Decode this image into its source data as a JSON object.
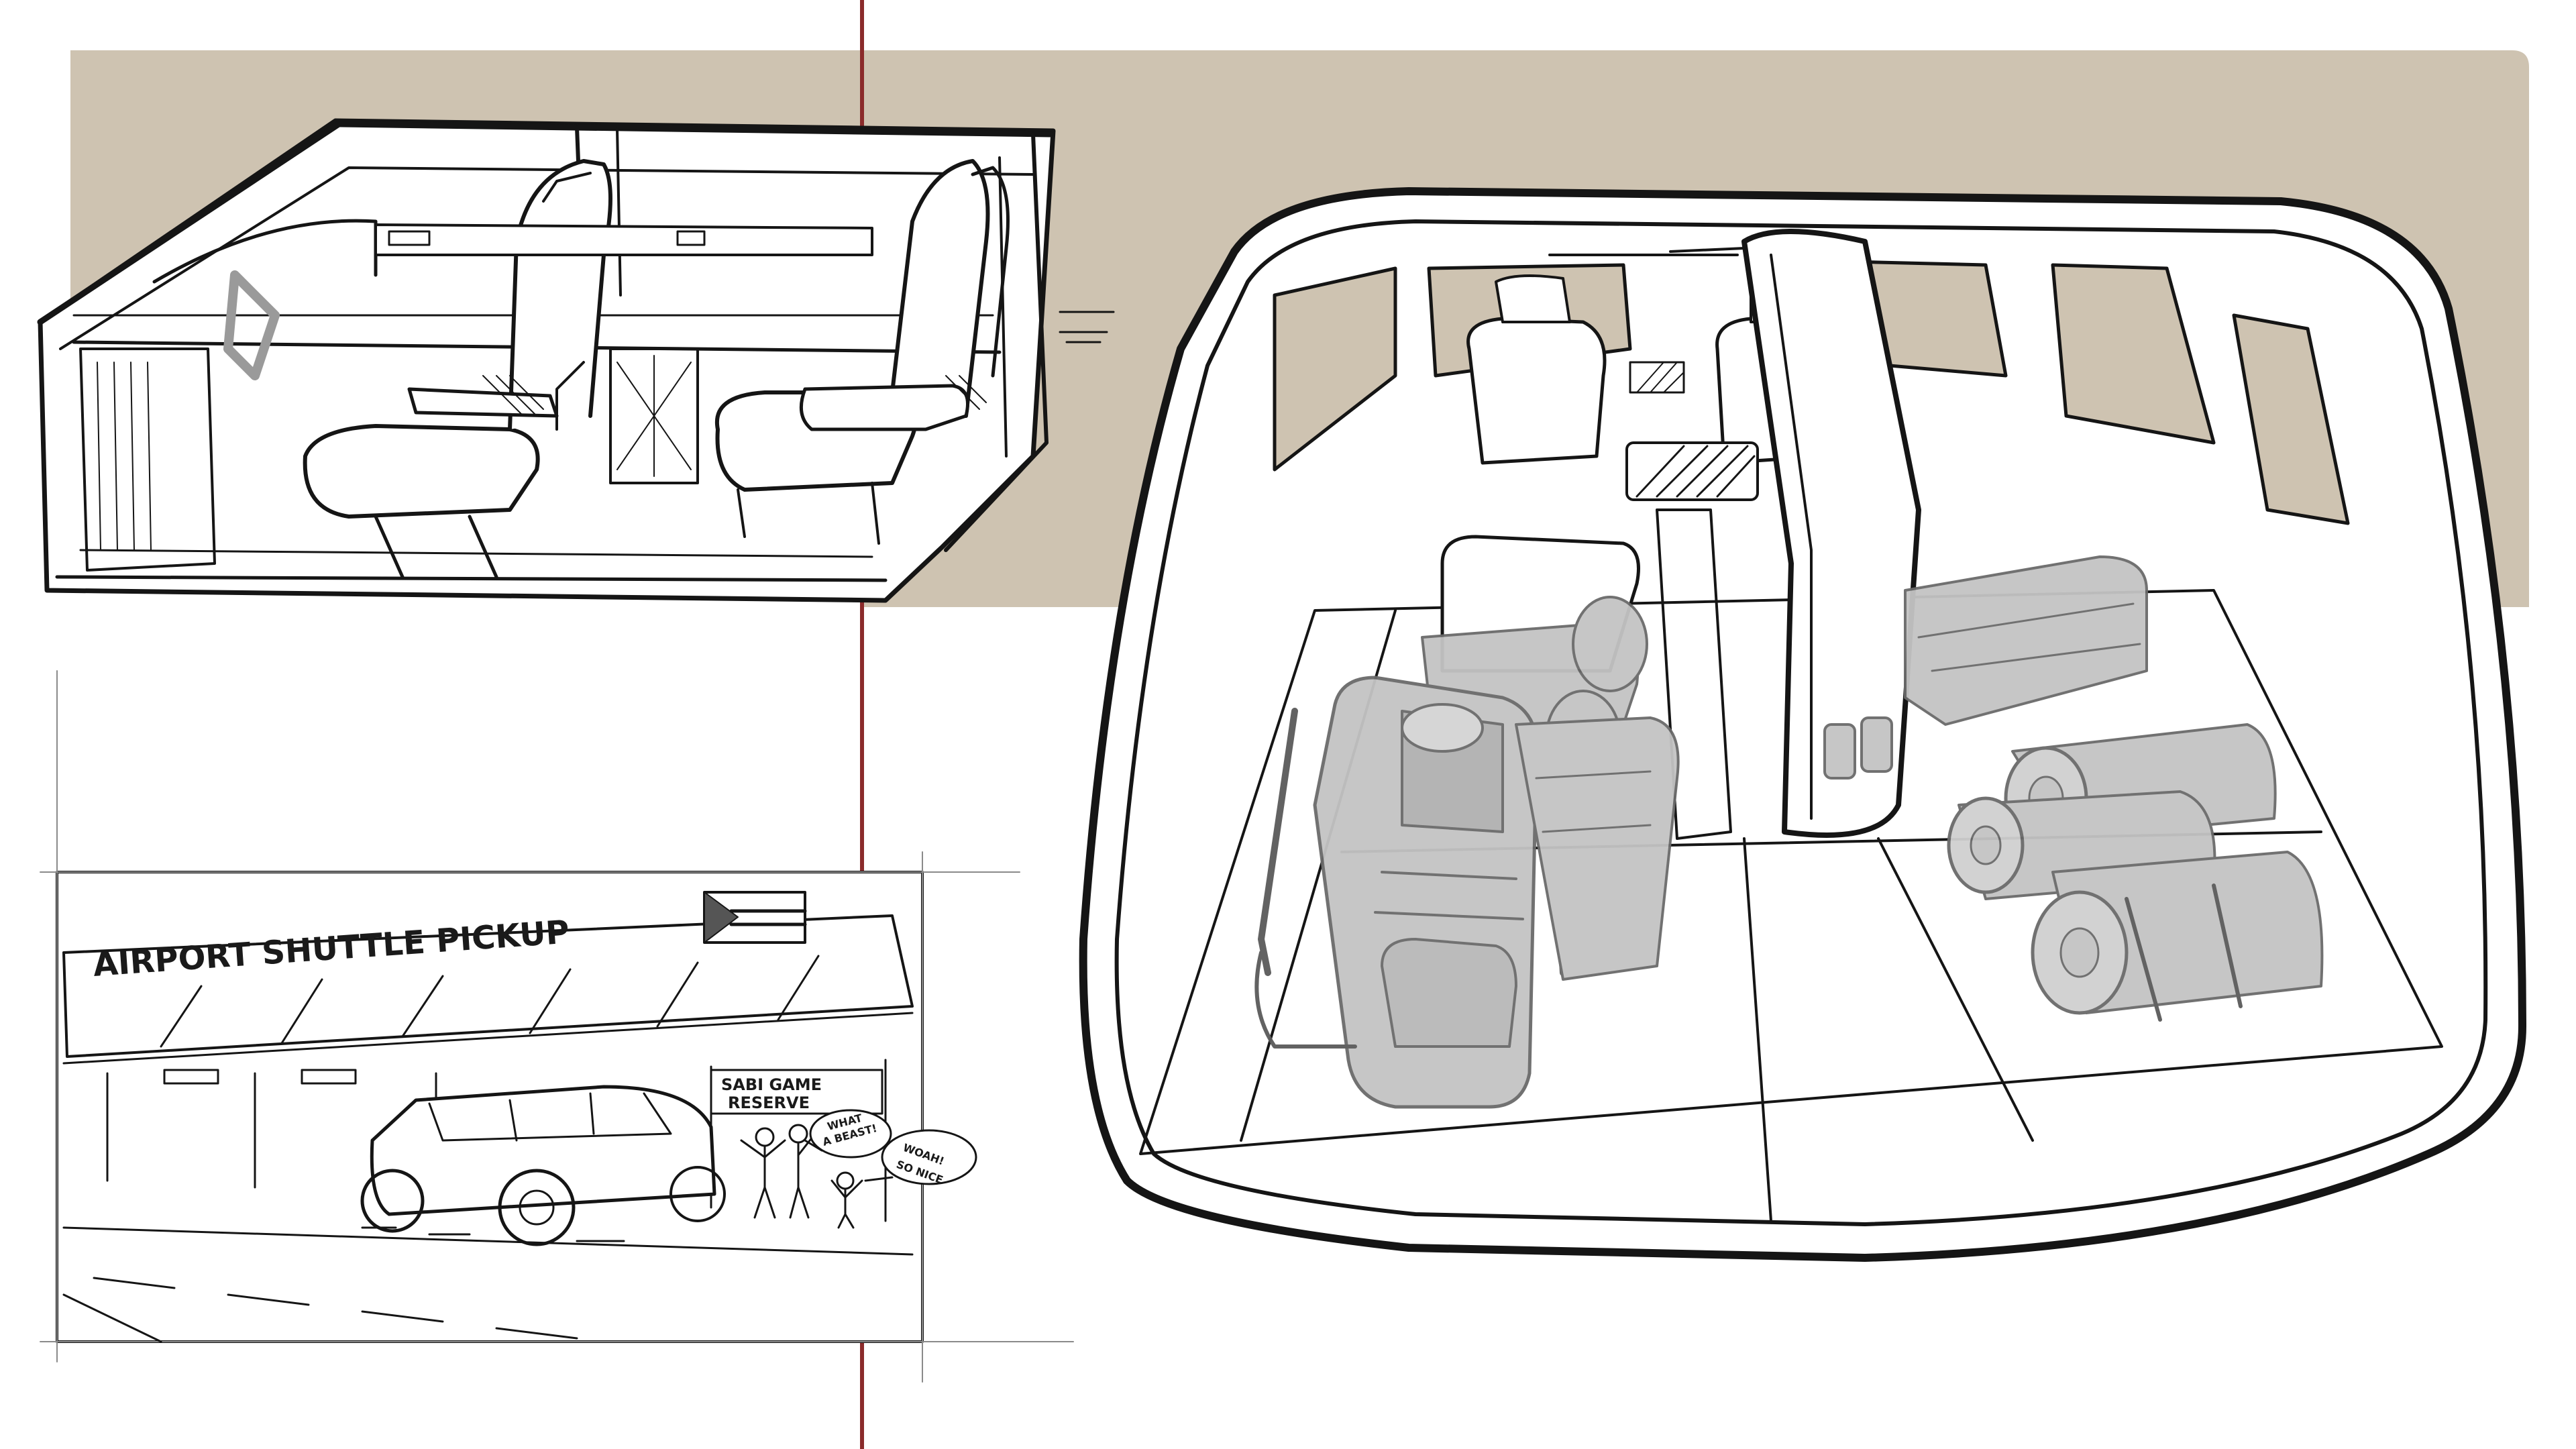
{
  "storyboard": {
    "banner_text": "AIRPORT  SHUTTLE  PICKUP",
    "sign_text_line1": "SABI GAME",
    "sign_text_line2": "RESERVE",
    "bubble1_line1": "WHAT",
    "bubble1_line2": "A BEAST!",
    "bubble2_line1": "WOAH!",
    "bubble2_line2": "SO NICE"
  },
  "colors": {
    "backdrop": "#cec3b1",
    "ink": "#151515",
    "divider": "#8b2b2b",
    "gear_gray": "#c4c4c4",
    "paper": "#ffffff"
  },
  "icons": {
    "flag": "flag-icon"
  }
}
